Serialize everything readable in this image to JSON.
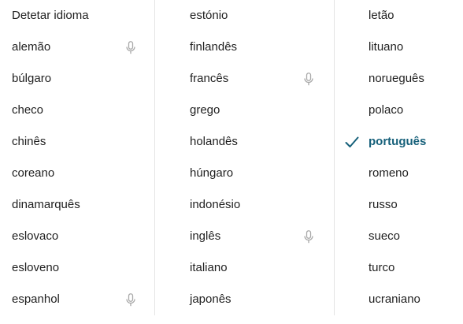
{
  "language_picker": {
    "columns": [
      {
        "items": [
          {
            "label": "Detetar idioma",
            "voice": false,
            "selected": false
          },
          {
            "label": "alemão",
            "voice": true,
            "selected": false
          },
          {
            "label": "búlgaro",
            "voice": false,
            "selected": false
          },
          {
            "label": "checo",
            "voice": false,
            "selected": false
          },
          {
            "label": "chinês",
            "voice": false,
            "selected": false
          },
          {
            "label": "coreano",
            "voice": false,
            "selected": false
          },
          {
            "label": "dinamarquês",
            "voice": false,
            "selected": false
          },
          {
            "label": "eslovaco",
            "voice": false,
            "selected": false
          },
          {
            "label": "esloveno",
            "voice": false,
            "selected": false
          },
          {
            "label": "espanhol",
            "voice": true,
            "selected": false
          }
        ]
      },
      {
        "items": [
          {
            "label": "estónio",
            "voice": false,
            "selected": false
          },
          {
            "label": "finlandês",
            "voice": false,
            "selected": false
          },
          {
            "label": "francês",
            "voice": true,
            "selected": false
          },
          {
            "label": "grego",
            "voice": false,
            "selected": false
          },
          {
            "label": "holandês",
            "voice": false,
            "selected": false
          },
          {
            "label": "húngaro",
            "voice": false,
            "selected": false
          },
          {
            "label": "indonésio",
            "voice": false,
            "selected": false
          },
          {
            "label": "inglês",
            "voice": true,
            "selected": false
          },
          {
            "label": "italiano",
            "voice": false,
            "selected": false
          },
          {
            "label": "japonês",
            "voice": false,
            "selected": false
          }
        ]
      },
      {
        "items": [
          {
            "label": "letão",
            "voice": false,
            "selected": false
          },
          {
            "label": "lituano",
            "voice": false,
            "selected": false
          },
          {
            "label": "norueguês",
            "voice": false,
            "selected": false
          },
          {
            "label": "polaco",
            "voice": false,
            "selected": false
          },
          {
            "label": "português",
            "voice": false,
            "selected": true
          },
          {
            "label": "romeno",
            "voice": false,
            "selected": false
          },
          {
            "label": "russo",
            "voice": false,
            "selected": false
          },
          {
            "label": "sueco",
            "voice": false,
            "selected": false
          },
          {
            "label": "turco",
            "voice": false,
            "selected": false
          },
          {
            "label": "ucraniano",
            "voice": false,
            "selected": false
          }
        ]
      }
    ]
  },
  "icons": {
    "voice_input": "microphone-icon",
    "selected_marker": "check-icon"
  },
  "colors": {
    "text": "#1f1f1f",
    "selected_text": "#16607a",
    "mic_icon": "#a8a8a8",
    "check_icon": "#16607a",
    "column_divider": "#e4e4e4",
    "background": "#ffffff"
  }
}
